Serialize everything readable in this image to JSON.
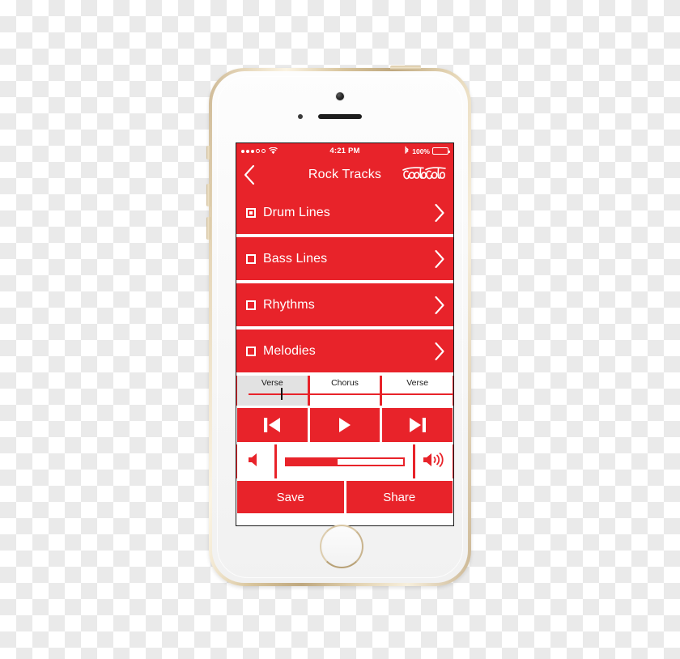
{
  "device": {
    "name": "iphone-5s-gold",
    "camera": "front-camera",
    "speaker": "earpiece-speaker",
    "home_button": "home-button"
  },
  "status_bar": {
    "signal_dots_filled": 3,
    "signal_dots_empty": 2,
    "wifi_icon": "wifi-icon",
    "time": "4:21 PM",
    "bluetooth_icon": "bluetooth-icon",
    "battery_percent": "100%",
    "battery_level": 100
  },
  "nav": {
    "back_icon": "chevron-left-icon",
    "title": "Rock Tracks",
    "brand": "Coca-Cola"
  },
  "tracks": [
    {
      "label": "Drum Lines",
      "checked": true,
      "chevron": "chevron-right-icon"
    },
    {
      "label": "Bass Lines",
      "checked": false,
      "chevron": "chevron-right-icon"
    },
    {
      "label": "Rhythms",
      "checked": false,
      "chevron": "chevron-right-icon"
    },
    {
      "label": "Melodies",
      "checked": false,
      "chevron": "chevron-right-icon"
    }
  ],
  "segments": [
    {
      "label": "Verse",
      "active": true
    },
    {
      "label": "Chorus",
      "active": false
    },
    {
      "label": "Verse",
      "active": false
    }
  ],
  "transport": {
    "previous": "skip-previous-icon",
    "play": "play-icon",
    "next": "skip-next-icon"
  },
  "volume": {
    "mute_icon": "volume-low-icon",
    "loud_icon": "volume-high-icon",
    "level_percent": 45
  },
  "actions": {
    "save": "Save",
    "share": "Share"
  },
  "colors": {
    "brand_red": "#e8232a",
    "screen_white": "#ffffff",
    "segment_active": "#e2e2e2",
    "playhead": "#111111"
  }
}
